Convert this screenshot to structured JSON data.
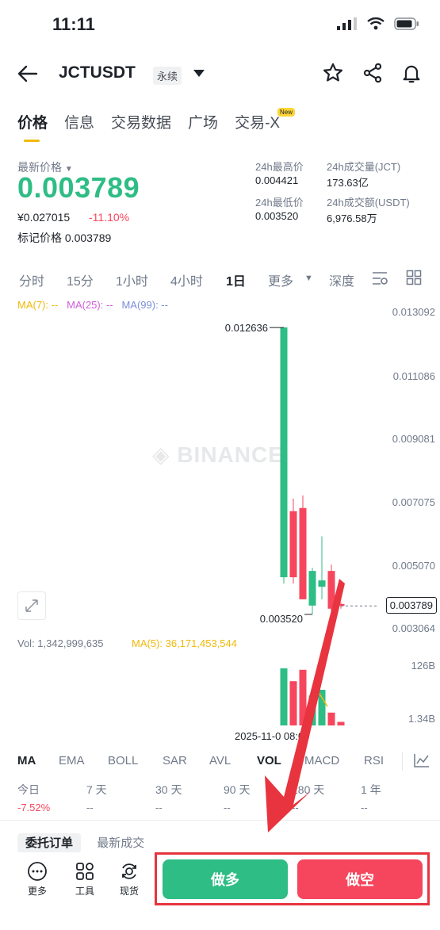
{
  "status": {
    "time": "11:11"
  },
  "header": {
    "pair": "JCTUSDT",
    "tag": "永续"
  },
  "tabs": [
    {
      "label": "价格",
      "active": true
    },
    {
      "label": "信息"
    },
    {
      "label": "交易数据"
    },
    {
      "label": "广场"
    },
    {
      "label": "交易-X"
    }
  ],
  "badge_new": "New",
  "ticker": {
    "latest_label": "最新价格",
    "price": "0.003789",
    "cny": "¥0.027015",
    "change": "-11.10%",
    "mark_label": "标记价格",
    "mark_value": "0.003789",
    "high_label": "24h最高价",
    "high": "0.004421",
    "low_label": "24h最低价",
    "low": "0.003520",
    "vol_label": "24h成交量(JCT)",
    "vol": "173.63亿",
    "amt_label": "24h成交额(USDT)",
    "amt": "6,976.58万"
  },
  "timeframes": [
    "分时",
    "15分",
    "1小时",
    "4小时",
    "1日",
    "更多",
    "深度"
  ],
  "ma": {
    "ma7": "MA(7): --",
    "ma25": "MA(25): --",
    "ma99": "MA(99): --"
  },
  "colors": {
    "up": "#2ebd85",
    "down": "#f6465d",
    "ma7": "#f0b90b",
    "ma25": "#d05edb",
    "ma99": "#7b8fdb",
    "accent": "#f0b90b"
  },
  "chart_data": {
    "type": "candlestick",
    "y_ticks": [
      "0.013092",
      "0.011086",
      "0.009081",
      "0.007075",
      "0.005070",
      "0.003064"
    ],
    "ylim": [
      0.003064,
      0.013092
    ],
    "high_label": "0.012636",
    "low_label": "0.003520",
    "last_price": "0.003789",
    "candles": [
      {
        "open": 0.0047,
        "close": 0.01264,
        "high": 0.01264,
        "low": 0.0045,
        "dir": "up"
      },
      {
        "open": 0.0068,
        "close": 0.0047,
        "high": 0.0072,
        "low": 0.0045,
        "dir": "down"
      },
      {
        "open": 0.0069,
        "close": 0.004,
        "high": 0.0073,
        "low": 0.004,
        "dir": "down"
      },
      {
        "open": 0.0038,
        "close": 0.0049,
        "high": 0.005,
        "low": 0.00352,
        "dir": "up"
      },
      {
        "open": 0.0046,
        "close": 0.0044,
        "high": 0.006,
        "low": 0.004,
        "dir": "up"
      },
      {
        "open": 0.0049,
        "close": 0.0037,
        "high": 0.0051,
        "low": 0.0036,
        "dir": "down"
      },
      {
        "open": 0.00385,
        "close": 0.00379,
        "high": 0.0039,
        "low": 0.0037,
        "dir": "down"
      }
    ],
    "volume": {
      "label": "Vol: 1,342,999,635",
      "ma5": "MA(5): 36,171,453,544",
      "ticks": [
        "126B",
        "1.34B"
      ],
      "bars": [
        0.8,
        0.62,
        0.78,
        0.42,
        0.5,
        0.18,
        0.05
      ],
      "dirs": [
        "up",
        "down",
        "down",
        "up",
        "up",
        "down",
        "down"
      ]
    },
    "x_label": "2025-11-0 08:00"
  },
  "watermark": "BINANCE",
  "indicators": [
    "MA",
    "EMA",
    "BOLL",
    "SAR",
    "AVL",
    "VOL",
    "MACD",
    "RSI"
  ],
  "performance": [
    {
      "label": "今日",
      "value": "-7.52%"
    },
    {
      "label": "7 天",
      "value": "--"
    },
    {
      "label": "30 天",
      "value": "--"
    },
    {
      "label": "90 天",
      "value": "--"
    },
    {
      "label": "180 天",
      "value": "--"
    },
    {
      "label": "1 年",
      "value": "--"
    }
  ],
  "orders": {
    "tab1": "委托订单",
    "tab2": "最新成交"
  },
  "bottom": {
    "more": "更多",
    "tools": "工具",
    "spot": "现货",
    "long": "做多",
    "short": "做空"
  }
}
